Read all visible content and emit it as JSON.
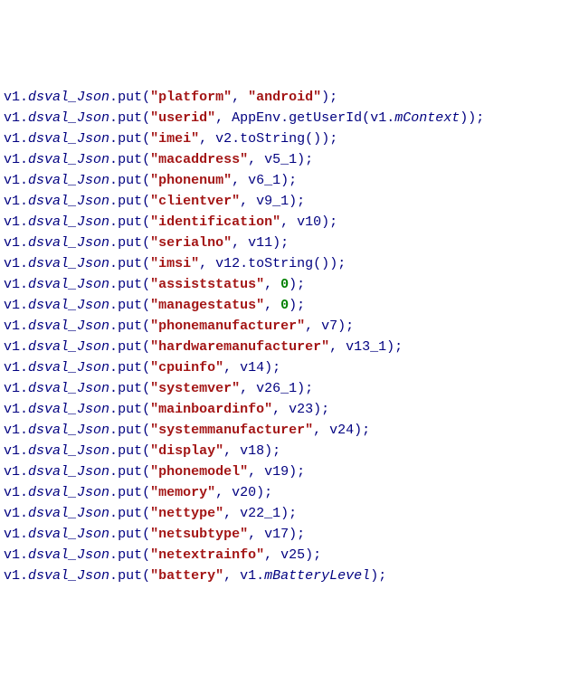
{
  "code": {
    "object": "v1",
    "member": "dsval_Json",
    "method": "put",
    "appenv": "AppEnv",
    "getUserId": "getUserId",
    "mContext": "mContext",
    "toString": "toString",
    "mBatteryLevel": "mBatteryLevel",
    "lines": [
      {
        "key": "platform",
        "valKind": "str",
        "valStr": "android"
      },
      {
        "key": "userid",
        "valKind": "appenv"
      },
      {
        "key": "imei",
        "valKind": "tostr",
        "var": "v2"
      },
      {
        "key": "macaddress",
        "valKind": "var",
        "var": "v5_1"
      },
      {
        "key": "phonenum",
        "valKind": "var",
        "var": "v6_1"
      },
      {
        "key": "clientver",
        "valKind": "var",
        "var": "v9_1"
      },
      {
        "key": "identification",
        "valKind": "var",
        "var": "v10"
      },
      {
        "key": "serialno",
        "valKind": "var",
        "var": "v11"
      },
      {
        "key": "imsi",
        "valKind": "tostr",
        "var": "v12"
      },
      {
        "key": "assiststatus",
        "valKind": "num",
        "num": "0"
      },
      {
        "key": "managestatus",
        "valKind": "num",
        "num": "0"
      },
      {
        "key": "phonemanufacturer",
        "valKind": "var",
        "var": "v7"
      },
      {
        "key": "hardwaremanufacturer",
        "valKind": "var",
        "var": "v13_1"
      },
      {
        "key": "cpuinfo",
        "valKind": "var",
        "var": "v14"
      },
      {
        "key": "systemver",
        "valKind": "var",
        "var": "v26_1"
      },
      {
        "key": "mainboardinfo",
        "valKind": "var",
        "var": "v23"
      },
      {
        "key": "systemmanufacturer",
        "valKind": "var",
        "var": "v24"
      },
      {
        "key": "display",
        "valKind": "var",
        "var": "v18"
      },
      {
        "key": "phonemodel",
        "valKind": "var",
        "var": "v19"
      },
      {
        "key": "memory",
        "valKind": "var",
        "var": "v20"
      },
      {
        "key": "nettype",
        "valKind": "var",
        "var": "v22_1"
      },
      {
        "key": "netsubtype",
        "valKind": "var",
        "var": "v17"
      },
      {
        "key": "netextrainfo",
        "valKind": "var",
        "var": "v25"
      },
      {
        "key": "battery",
        "valKind": "battery"
      }
    ]
  }
}
